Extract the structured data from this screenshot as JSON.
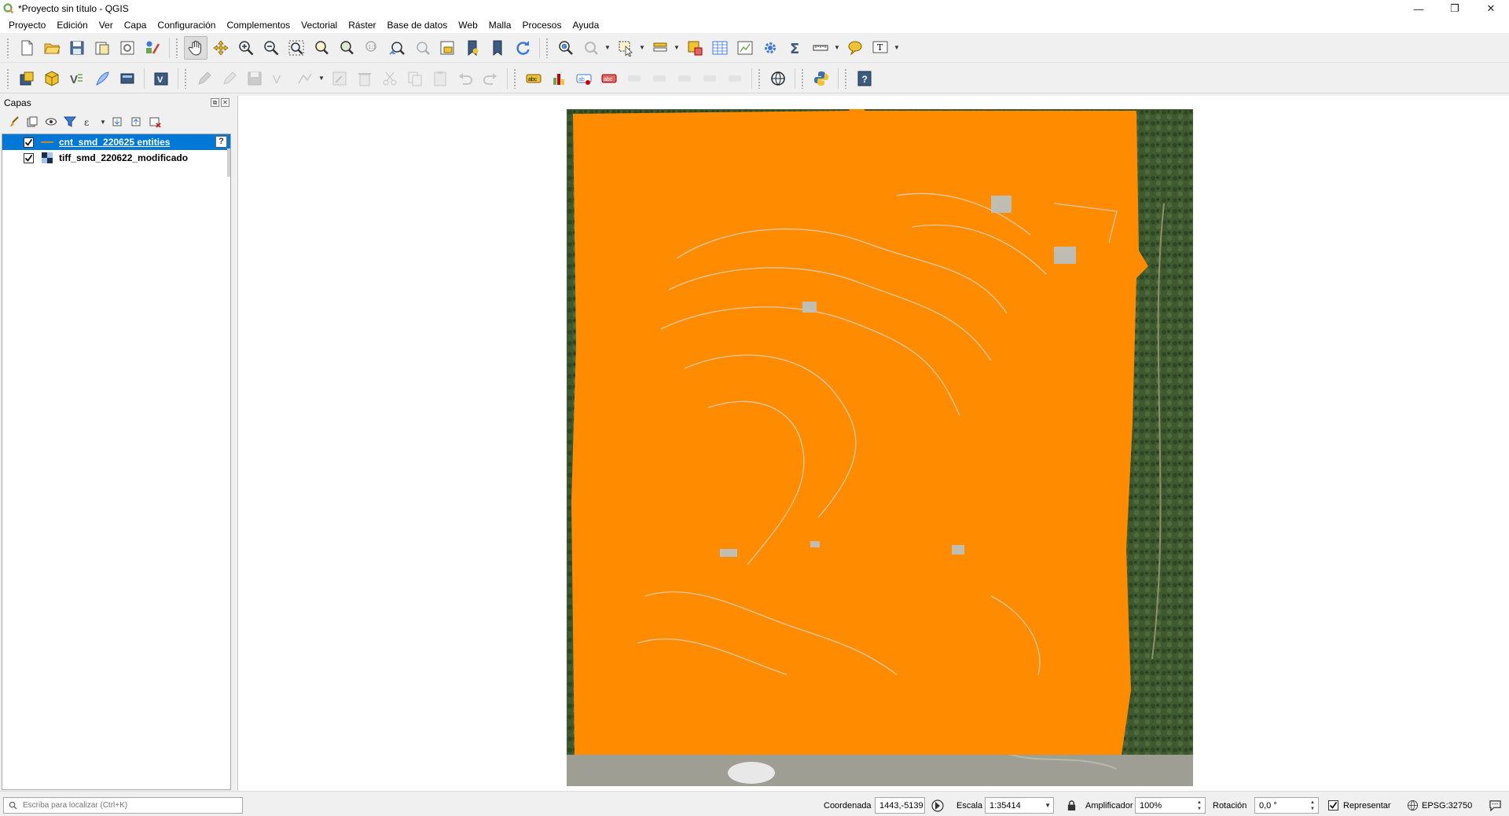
{
  "window": {
    "title": "*Proyecto sin título - QGIS",
    "minimize": "—",
    "restore": "❐",
    "close": "✕"
  },
  "menu": [
    "Proyecto",
    "Edición",
    "Ver",
    "Capa",
    "Configuración",
    "Complementos",
    "Vectorial",
    "Ráster",
    "Base de datos",
    "Web",
    "Malla",
    "Procesos",
    "Ayuda"
  ],
  "layers_panel": {
    "title": "Capas",
    "layers": [
      {
        "name": "cnt_smd_220625 entities",
        "checked": true,
        "selected": true,
        "type": "line"
      },
      {
        "name": "tiff_smd_220622_modificado",
        "checked": true,
        "selected": false,
        "type": "raster"
      }
    ],
    "help_badge": "?"
  },
  "status": {
    "locator_placeholder": "Escriba para localizar (Ctrl+K)",
    "coordinate_label": "Coordenada",
    "coordinate_value": "1443,-5139",
    "scale_label": "Escala",
    "scale_value": "1:35414",
    "magnifier_label": "Amplificador",
    "magnifier_value": "100%",
    "rotation_label": "Rotación",
    "rotation_value": "0,0 °",
    "render_label": "Representar",
    "render_checked": true,
    "crs": "EPSG:32750"
  },
  "colors": {
    "overlay": "#ff8c00",
    "selection": "#0078d7",
    "raster_green": "#3f5a30"
  }
}
